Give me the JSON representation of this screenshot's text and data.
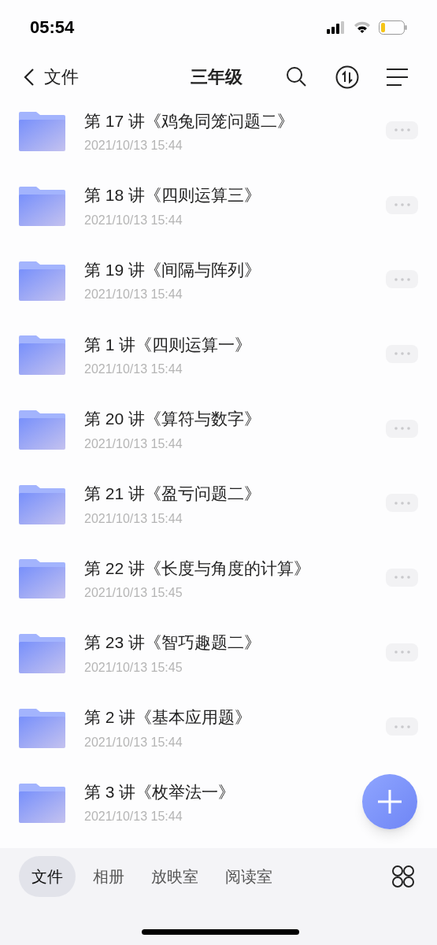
{
  "status_bar": {
    "time": "05:54"
  },
  "nav": {
    "back_label": "文件",
    "title": "三年级"
  },
  "files": [
    {
      "name": "第 17 讲《鸡兔同笼问题二》",
      "date": "2021/10/13 15:44"
    },
    {
      "name": "第 18 讲《四则运算三》",
      "date": "2021/10/13 15:44"
    },
    {
      "name": "第 19 讲《间隔与阵列》",
      "date": "2021/10/13 15:44"
    },
    {
      "name": "第 1 讲《四则运算一》",
      "date": "2021/10/13 15:44"
    },
    {
      "name": "第 20 讲《算符与数字》",
      "date": "2021/10/13 15:44"
    },
    {
      "name": "第 21 讲《盈亏问题二》",
      "date": "2021/10/13 15:44"
    },
    {
      "name": "第 22 讲《长度与角度的计算》",
      "date": "2021/10/13 15:45"
    },
    {
      "name": "第 23 讲《智巧趣题二》",
      "date": "2021/10/13 15:45"
    },
    {
      "name": "第 2 讲《基本应用题》",
      "date": "2021/10/13 15:44"
    },
    {
      "name": "第 3 讲《枚举法一》",
      "date": "2021/10/13 15:44"
    }
  ],
  "tabs": [
    {
      "label": "文件",
      "selected": true
    },
    {
      "label": "相册",
      "selected": false
    },
    {
      "label": "放映室",
      "selected": false
    },
    {
      "label": "阅读室",
      "selected": false
    }
  ]
}
